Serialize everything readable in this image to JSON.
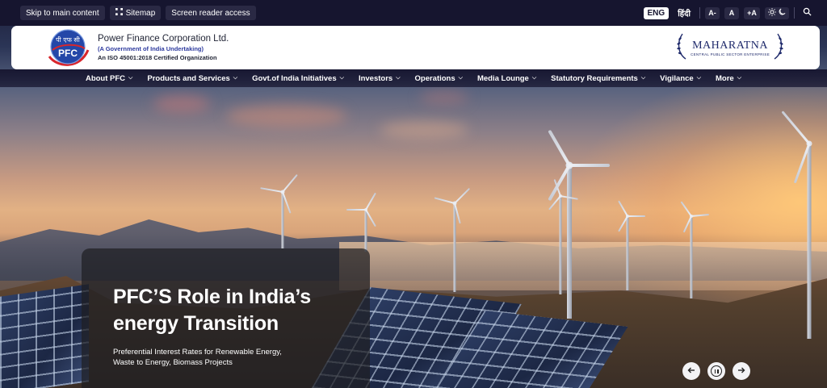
{
  "topbar": {
    "skip_link": "Skip to main content",
    "sitemap": "Sitemap",
    "screen_reader": "Screen reader access",
    "lang_en": "ENG",
    "lang_hi": "हिंदी",
    "font_decrease": "A-",
    "font_normal": "A",
    "font_increase": "+A",
    "icons": [
      "sitemap-icon",
      "sun-icon",
      "moon-icon",
      "search-icon"
    ]
  },
  "header": {
    "logo_text_hindi": "पी एफ सी",
    "logo_text": "PFC",
    "org_name": "Power Finance Corporation Ltd.",
    "org_sub": "(A Government of India Undertaking)",
    "org_iso": "An ISO 45001:2018 Certified Organization",
    "maharatna_title": "MAHARATNA",
    "maharatna_sub": "CENTRAL PUBLIC SECTOR ENTERPRISE"
  },
  "nav": {
    "items": [
      {
        "label": "About PFC"
      },
      {
        "label": "Products and Services"
      },
      {
        "label": "Govt.of India Initiatives"
      },
      {
        "label": "Investors"
      },
      {
        "label": "Operations"
      },
      {
        "label": "Media Lounge"
      },
      {
        "label": "Statutory Requirements"
      },
      {
        "label": "Vigilance"
      },
      {
        "label": "More"
      }
    ]
  },
  "slide": {
    "title_line1": "PFC’S Role in India’s",
    "title_line2": "energy Transition",
    "desc_line1": "Preferential Interest Rates for Renewable Energy,",
    "desc_line2": "Waste to Energy, Biomass Projects"
  },
  "controls": {
    "prev_icon": "arrow-left-icon",
    "pause_icon": "pause-icon",
    "next_icon": "arrow-right-icon"
  },
  "colors": {
    "topbar_bg": "#16152f",
    "chip_bg": "#2a2944",
    "brand_blue": "#2d3a9e",
    "maharatna_blue": "#1f2a6b",
    "card_bg": "#1e1e22"
  }
}
